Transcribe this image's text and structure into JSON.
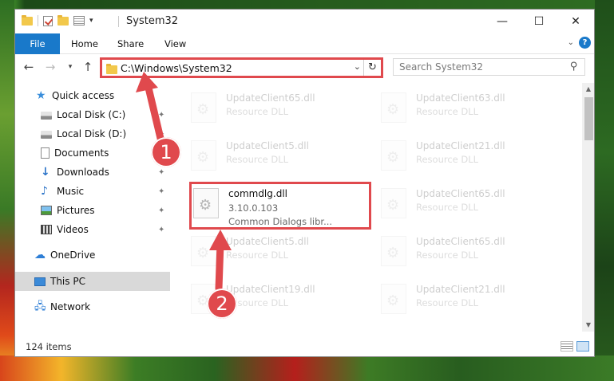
{
  "window": {
    "title": "System32",
    "controls": {
      "minimize": "—",
      "maximize": "☐",
      "close": "✕"
    }
  },
  "ribbon": {
    "tabs": [
      "File",
      "Home",
      "Share",
      "View"
    ]
  },
  "address": {
    "path": "C:\\Windows\\System32",
    "search_placeholder": "Search System32"
  },
  "nav": {
    "items": [
      {
        "label": "Quick access",
        "icon": "star-icon"
      },
      {
        "label": "Local Disk (C:)",
        "icon": "drive-icon",
        "pinned": true
      },
      {
        "label": "Local Disk (D:)",
        "icon": "drive-icon",
        "pinned": true
      },
      {
        "label": "Documents",
        "icon": "documents-icon",
        "pinned": true
      },
      {
        "label": "Downloads",
        "icon": "downloads-icon",
        "pinned": true
      },
      {
        "label": "Music",
        "icon": "music-icon",
        "pinned": true
      },
      {
        "label": "Pictures",
        "icon": "pictures-icon",
        "pinned": true
      },
      {
        "label": "Videos",
        "icon": "videos-icon",
        "pinned": true
      },
      {
        "label": "OneDrive",
        "icon": "cloud-icon"
      },
      {
        "label": "This PC",
        "icon": "computer-icon",
        "selected": true
      },
      {
        "label": "Network",
        "icon": "network-icon"
      }
    ]
  },
  "files": {
    "left": [
      {
        "name": "UpdateClient65.dll",
        "desc": "Resource DLL"
      },
      {
        "name": "UpdateClient5.dll",
        "desc": "Resource DLL"
      },
      {
        "name": "commdlg.dll",
        "version": "3.10.0.103",
        "desc": "Common Dialogs libr...",
        "highlight": true
      },
      {
        "name": "UpdateClient5.dll",
        "desc": "Resource DLL"
      },
      {
        "name": "UpdateClient19.dll",
        "desc": "Resource DLL"
      }
    ],
    "right": [
      {
        "name": "UpdateClient63.dll",
        "desc": "Resource DLL"
      },
      {
        "name": "UpdateClient21.dll",
        "desc": "Resource DLL"
      },
      {
        "name": "UpdateClient65.dll",
        "desc": "Resource DLL"
      },
      {
        "name": "UpdateClient65.dll",
        "desc": "Resource DLL"
      },
      {
        "name": "UpdateClient21.dll",
        "desc": "Resource DLL"
      }
    ]
  },
  "status": {
    "item_count": "124 items"
  },
  "annotations": {
    "step1": "1",
    "step2": "2",
    "accent": "#e0494d"
  }
}
